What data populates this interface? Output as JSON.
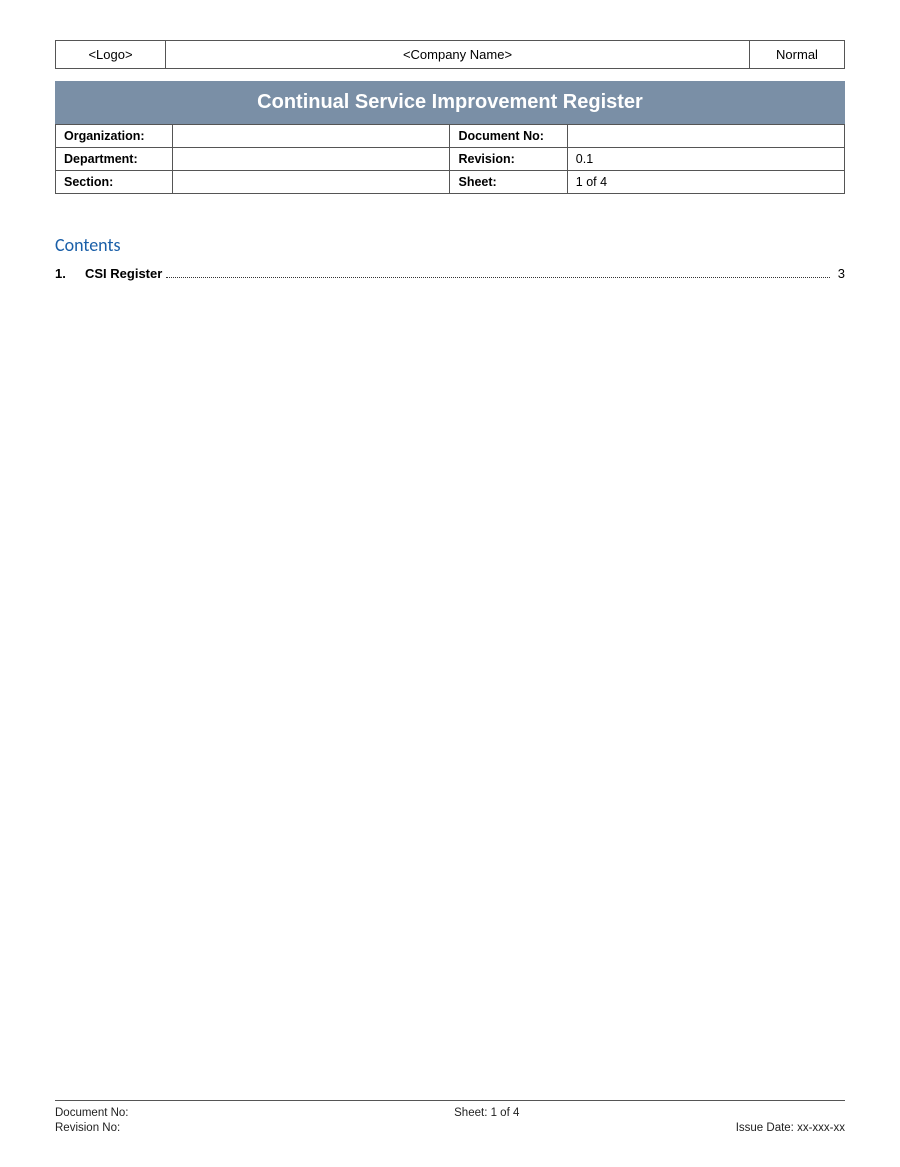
{
  "header": {
    "logo_label": "<Logo>",
    "company_name": "<Company Name>",
    "normal_label": "Normal"
  },
  "title": {
    "text": "Continual Service Improvement Register"
  },
  "info_table": {
    "rows": [
      {
        "left_label": "Organization:",
        "left_value": "",
        "right_label": "Document No:",
        "right_value": ""
      },
      {
        "left_label": "Department:",
        "left_value": "",
        "right_label": "Revision:",
        "right_value": "0.1"
      },
      {
        "left_label": "Section:",
        "left_value": "",
        "right_label": "Sheet:",
        "right_value": "1 of 4"
      }
    ]
  },
  "contents": {
    "title": "Contents",
    "items": [
      {
        "number": "1.",
        "label": "CSI Register",
        "page": "3"
      }
    ]
  },
  "footer": {
    "document_no_label": "Document No:",
    "revision_no_label": "Revision No:",
    "sheet_label": "Sheet: 1 of 4",
    "issue_date_label": "Issue Date: xx-xxx-xx"
  }
}
